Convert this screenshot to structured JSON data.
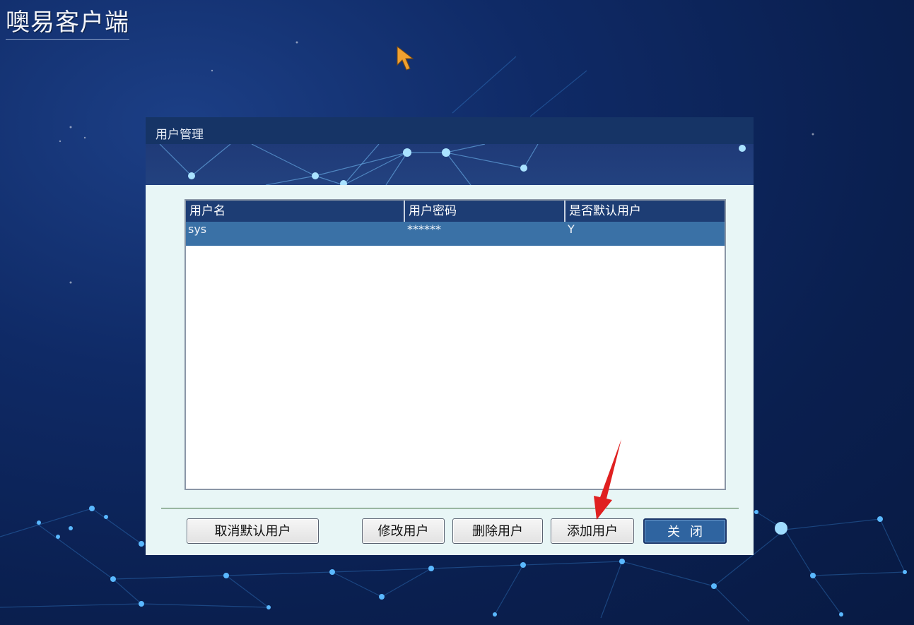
{
  "app": {
    "title": "噢易客户端"
  },
  "dialog": {
    "title": "用户管理"
  },
  "table": {
    "headers": [
      "用户名",
      "用户密码",
      "是否默认用户"
    ],
    "rows": [
      {
        "username": "sys",
        "password": "******",
        "default": "Y"
      }
    ]
  },
  "buttons": {
    "cancel_default": "取消默认用户",
    "edit_user": "修改用户",
    "delete_user": "删除用户",
    "add_user": "添加用户",
    "close": "关闭"
  },
  "colors": {
    "background": "#0f2a66",
    "titlebar": "#163466",
    "selected_row": "#3a71a6",
    "dialog_body": "#e8f6f6",
    "cursor": "#f0a030",
    "annotation_arrow": "#e02020"
  },
  "icons": {
    "cursor": "mouse-pointer-icon",
    "annotation": "red-arrow-annotation"
  }
}
